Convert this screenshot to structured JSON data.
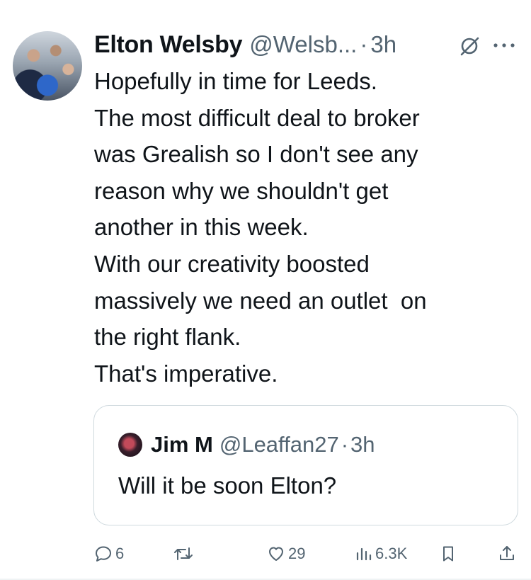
{
  "tweet": {
    "author_name": "Elton Welsby",
    "author_handle": "@Welsb...",
    "separator": "·",
    "time": "3h",
    "text_lines": [
      "Hopefully in time for Leeds.",
      "The most difficult deal to broker",
      "was Grealish so I don't see any",
      "reason why we shouldn't get",
      "another in this week.",
      "With our creativity boosted",
      "massively we need an outlet  on",
      "the right flank.",
      "That's imperative."
    ]
  },
  "quote": {
    "author_name": "Jim M",
    "author_handle": "@Leaffan27",
    "separator": "·",
    "time": "3h",
    "text": "Will it be soon Elton?"
  },
  "actions": {
    "replies": "6",
    "retweets": "",
    "likes": "29",
    "views": "6.3K"
  },
  "icons": {
    "grok": "grok-icon",
    "more": "more-dots-icon",
    "reply": "reply-icon",
    "retweet": "retweet-icon",
    "like": "heart-icon",
    "views": "views-bar-icon",
    "bookmark": "bookmark-icon",
    "share": "share-icon"
  },
  "colors": {
    "text": "#0f1419",
    "secondary": "#536471",
    "border": "#cfd9de"
  }
}
